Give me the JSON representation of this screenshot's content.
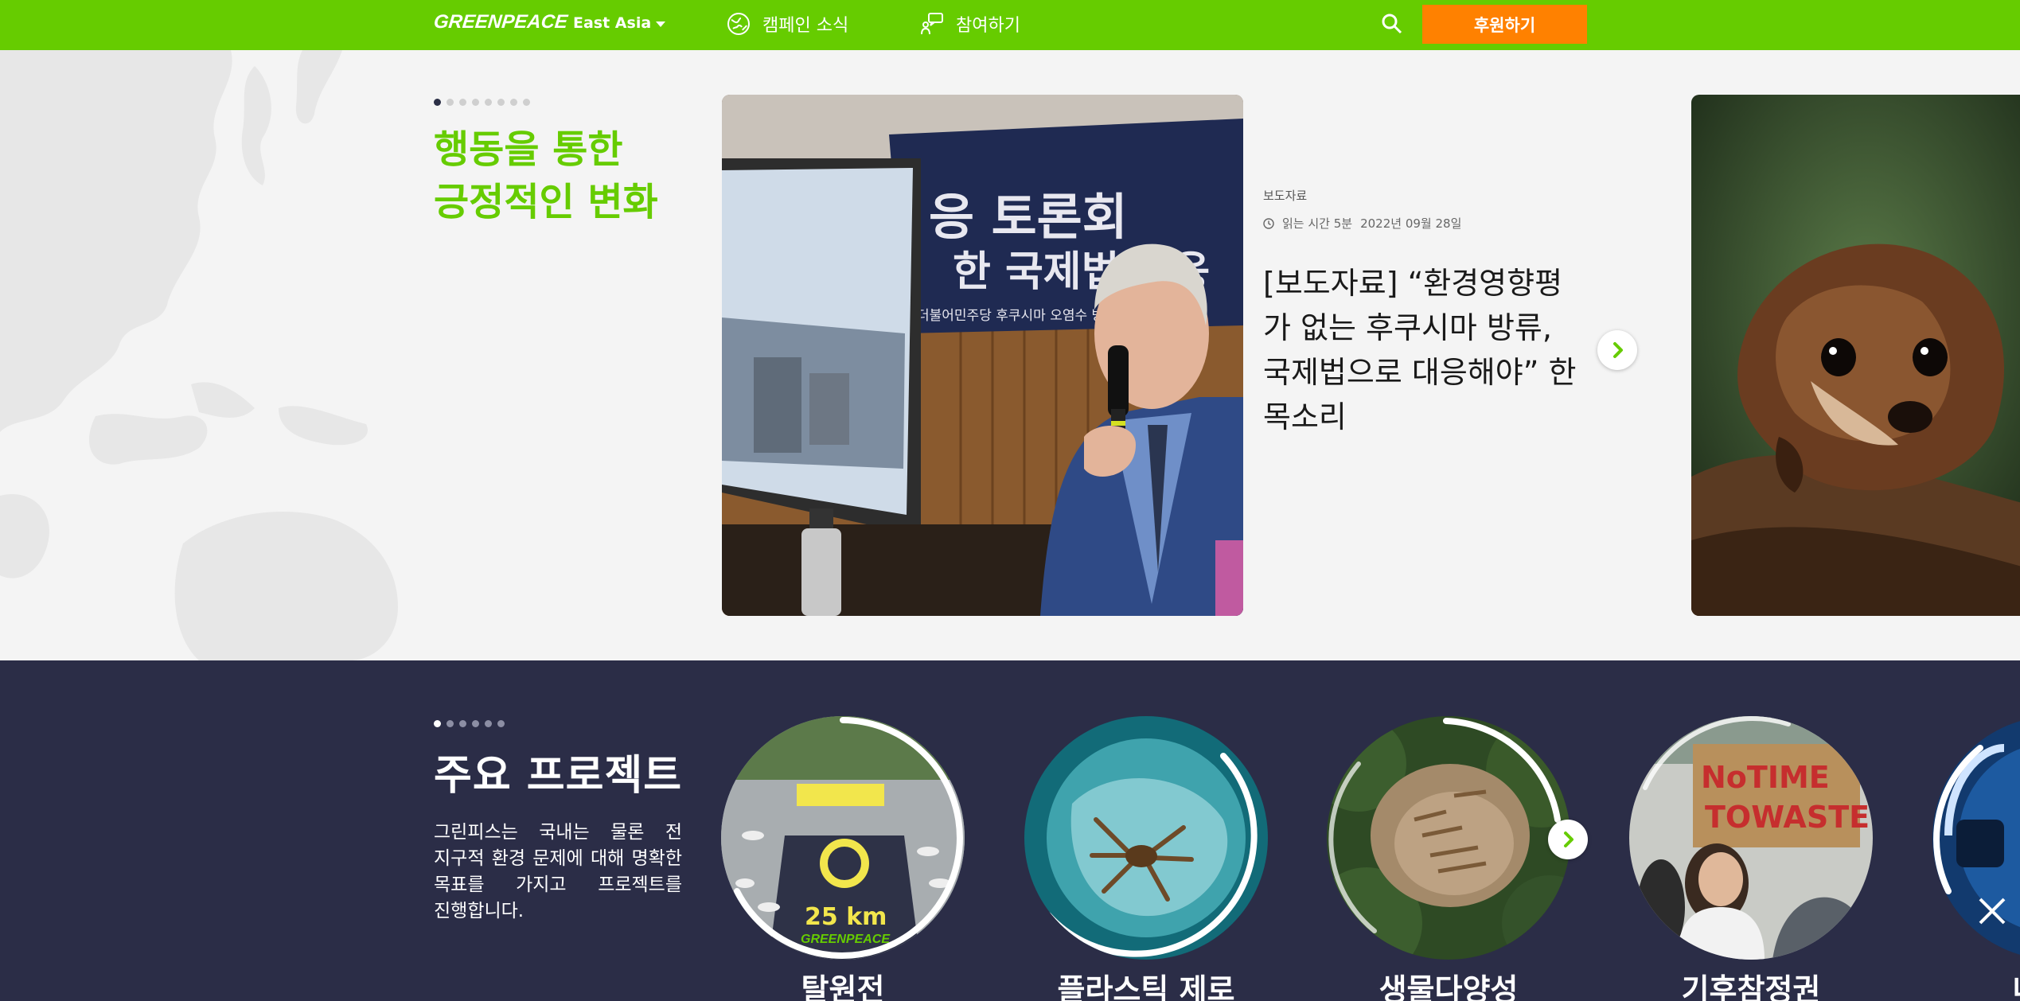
{
  "header": {
    "logo": "GREENPEACE",
    "region": "East Asia",
    "nav": [
      {
        "label": "캠페인 소식",
        "icon": "globe-icon"
      },
      {
        "label": "참여하기",
        "icon": "chat-icon"
      }
    ],
    "search_icon": "search-icon",
    "donate_label": "후원하기",
    "colors": {
      "brand_green": "#66cc00",
      "donate_orange": "#ff8100",
      "navy": "#2b2d47"
    }
  },
  "hero": {
    "title": "행동을 통한 긍정적인 변화",
    "slide_count": 8,
    "active_slide": 1,
    "article": {
      "kicker": "보도자료",
      "read_time": "읽는 시간 5분",
      "date": "2022년 09월 28일",
      "title": "[보도자료] “환경영향평가 없는 후쿠시마 방류, 국제법으로 대응해야” 한목소리"
    },
    "photo_banner_top": "응 토론회",
    "photo_banner_mid": "한 국제법 대응",
    "photo_banner_small": "더불어민주당 후쿠시마 오염수 방출 저지"
  },
  "projects": {
    "title": "주요 프로젝트",
    "description": "그린피스는 국내는 물론 전 지구적 환경 문제에 대해 명확한 목표를 가지고 프로젝트를 진행합니다.",
    "slide_count": 6,
    "active_slide": 1,
    "items": [
      {
        "label": "탈원전",
        "photo_text": "25 km",
        "photo_brand": "GREENPEACE"
      },
      {
        "label": "플라스틱 제로"
      },
      {
        "label": "생물다양성"
      },
      {
        "label": "기후참정권",
        "sign_line1": "NoTIME",
        "sign_line2": "TOWASTE"
      },
      {
        "label": "내연기"
      }
    ]
  }
}
